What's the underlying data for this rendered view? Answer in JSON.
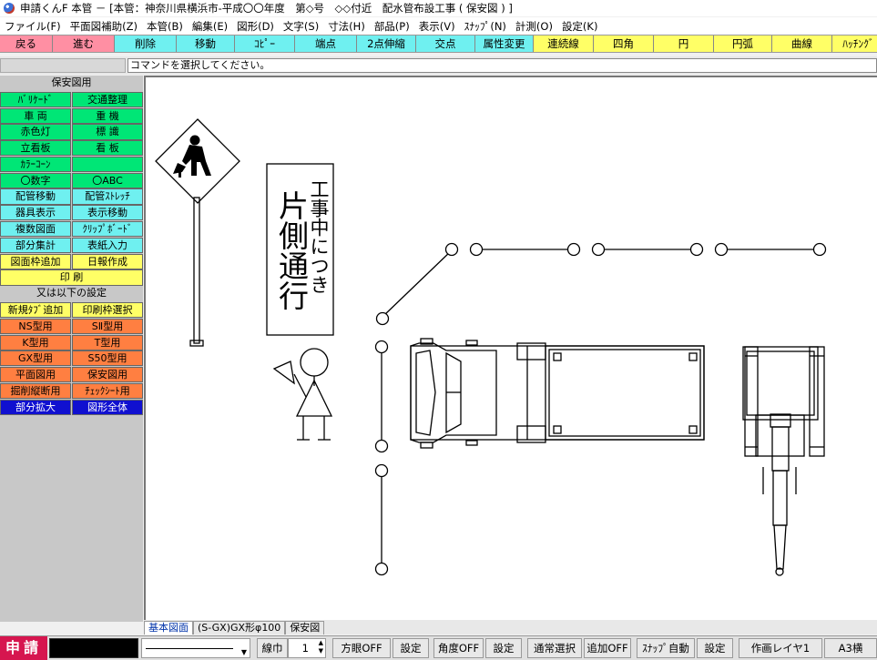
{
  "window": {
    "title": "申請くんF 本管 － [本管：神奈川県横浜市-平成〇〇年度　第◇号　◇◇付近　配水管布設工事 ( 保安図 ) ]"
  },
  "menu": [
    "ファイル(F)",
    "平面図補助(Z)",
    "本管(B)",
    "編集(E)",
    "図形(D)",
    "文字(S)",
    "寸法(H)",
    "部品(P)",
    "表示(V)",
    "ｽﾅｯﾌﾟ(N)",
    "計測(O)",
    "設定(K)"
  ],
  "toolbar": [
    {
      "label": "戻る",
      "color": "#ff8fa3",
      "w": 58
    },
    {
      "label": "進む",
      "color": "#ff8fa3",
      "w": 68
    },
    {
      "label": "削除",
      "color": "#6ff0f0",
      "w": 68
    },
    {
      "label": "移動",
      "color": "#6ff0f0",
      "w": 64
    },
    {
      "label": "ｺﾋﾟｰ",
      "color": "#6ff0f0",
      "w": 66
    },
    {
      "label": "端点",
      "color": "#6ff0f0",
      "w": 68
    },
    {
      "label": "2点伸縮",
      "color": "#6ff0f0",
      "w": 65
    },
    {
      "label": "交点",
      "color": "#6ff0f0",
      "w": 65
    },
    {
      "label": "属性変更",
      "color": "#6ff0f0",
      "w": 64
    },
    {
      "label": "連続線",
      "color": "#ffff66",
      "w": 66
    },
    {
      "label": "四角",
      "color": "#ffff66",
      "w": 66
    },
    {
      "label": "円",
      "color": "#ffff66",
      "w": 66
    },
    {
      "label": "円弧",
      "color": "#ffff66",
      "w": 64
    },
    {
      "label": "曲線",
      "color": "#ffff66",
      "w": 66
    },
    {
      "label": "ﾊｯﾁﾝｸﾞ",
      "color": "#ffff66",
      "w": 58
    }
  ],
  "command_message": "コマンドを選択してください。",
  "left_panel": [
    [
      {
        "label": "保安図用",
        "color": "head"
      }
    ],
    [
      {
        "label": "ﾊﾞﾘｹｰﾄﾞ",
        "color": "#00e676"
      },
      {
        "label": "交通整理",
        "color": "#00e676"
      }
    ],
    [
      {
        "label": "車 両",
        "color": "#00e676"
      },
      {
        "label": "重 機",
        "color": "#00e676"
      }
    ],
    [
      {
        "label": "赤色灯",
        "color": "#00e676"
      },
      {
        "label": "標 識",
        "color": "#00e676"
      }
    ],
    [
      {
        "label": "立看板",
        "color": "#00e676"
      },
      {
        "label": "看 板",
        "color": "#00e676"
      }
    ],
    [
      {
        "label": "ｶﾗｰｺｰﾝ",
        "color": "#00e676"
      },
      {
        "label": "",
        "color": "#00e676"
      }
    ],
    [
      {
        "label": "〇数字",
        "color": "#00e676"
      },
      {
        "label": "〇ABC",
        "color": "#00e676"
      }
    ],
    [
      {
        "label": "配管移動",
        "color": "#6ff0f0"
      },
      {
        "label": "配管ｽﾄﾚｯﾁ",
        "color": "#6ff0f0"
      }
    ],
    [
      {
        "label": "器具表示",
        "color": "#6ff0f0"
      },
      {
        "label": "表示移動",
        "color": "#6ff0f0"
      }
    ],
    [
      {
        "label": "複数図面",
        "color": "#6ff0f0"
      },
      {
        "label": "ｸﾘｯﾌﾟﾎﾞｰﾄﾞ",
        "color": "#6ff0f0"
      }
    ],
    [
      {
        "label": "部分集計",
        "color": "#6ff0f0"
      },
      {
        "label": "表紙入力",
        "color": "#6ff0f0"
      }
    ],
    [
      {
        "label": "図面枠追加",
        "color": "#ffff66"
      },
      {
        "label": "日報作成",
        "color": "#ffff66"
      }
    ],
    [
      {
        "label": "印 刷",
        "color": "#ffff66"
      }
    ],
    [
      {
        "label": "又は以下の設定",
        "color": "head"
      }
    ],
    [
      {
        "label": "新規ﾀﾌﾞ追加",
        "color": "#ffff66"
      },
      {
        "label": "印刷枠選択",
        "color": "#ffff66"
      }
    ],
    [
      {
        "label": "NS型用",
        "color": "#ff7f41"
      },
      {
        "label": "SⅡ型用",
        "color": "#ff7f41"
      }
    ],
    [
      {
        "label": "K型用",
        "color": "#ff7f41"
      },
      {
        "label": "T型用",
        "color": "#ff7f41"
      }
    ],
    [
      {
        "label": "GX型用",
        "color": "#ff7f41"
      },
      {
        "label": "S50型用",
        "color": "#ff7f41"
      }
    ],
    [
      {
        "label": "平面図用",
        "color": "#ff7f41"
      },
      {
        "label": "保安図用",
        "color": "#ff7f41"
      }
    ],
    [
      {
        "label": "掘削縦断用",
        "color": "#ff7f41"
      },
      {
        "label": "ﾁｪｯｸｼｰﾄ用",
        "color": "#ff7f41"
      }
    ],
    [
      {
        "label": "部分拡大",
        "color": "#1010d0"
      },
      {
        "label": "図形全体",
        "color": "#1010d0"
      }
    ]
  ],
  "signboard": {
    "col1": "工事中につき",
    "col2": "片側通行"
  },
  "tabs": [
    {
      "label": "基本図面",
      "active": true
    },
    {
      "label": "(S-GX)GX形φ100",
      "active": false
    },
    {
      "label": "保安図",
      "active": false
    }
  ],
  "status": {
    "brand": "申請",
    "line_width_label": "線巾",
    "line_width_value": "1",
    "ortho_off": "方眼OFF",
    "ortho_set": "設定",
    "angle_off": "角度OFF",
    "angle_set": "設定",
    "normal_select": "通常選択",
    "add_off": "追加OFF",
    "snap_auto": "ｽﾅｯﾌﾟ自動",
    "snap_set": "設定",
    "layer": "作画レイヤ1",
    "paper": "A3横"
  }
}
